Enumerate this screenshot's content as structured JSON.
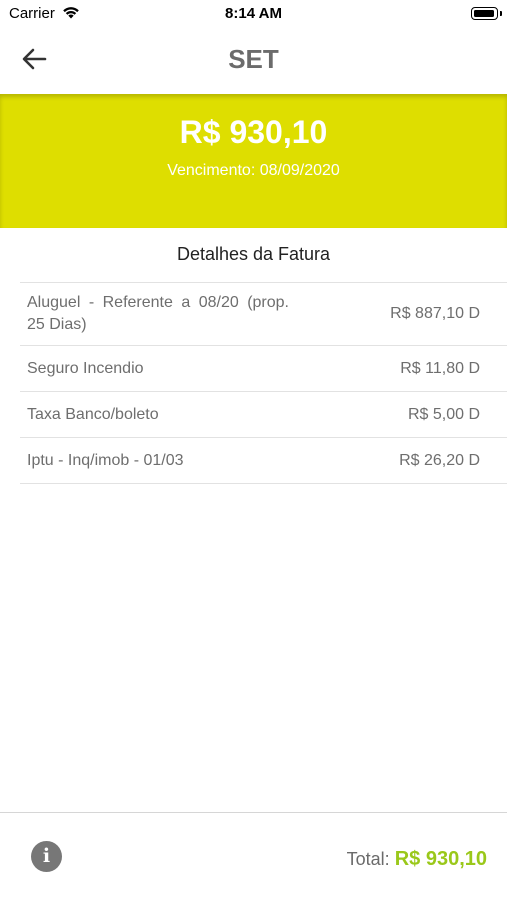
{
  "status": {
    "carrier": "Carrier",
    "time": "8:14 AM"
  },
  "nav": {
    "title": "SET"
  },
  "banner": {
    "amount": "R$ 930,10",
    "due": "Vencimento: 08/09/2020"
  },
  "details": {
    "title": "Detalhes da Fatura",
    "items": [
      {
        "description": "Aluguel - Referente a 08/20 (prop. 25 Dias)",
        "value": "R$ 887,10 D"
      },
      {
        "description": "Seguro Incendio",
        "value": "R$ 11,80 D"
      },
      {
        "description": "Taxa Banco/boleto",
        "value": "R$ 5,00 D"
      },
      {
        "description": "Iptu - Inq/imob - 01/03",
        "value": "R$ 26,20 D"
      }
    ]
  },
  "footer": {
    "total_label": "Total:",
    "total_amount": "R$ 930,10"
  },
  "icons": {
    "back": "arrow-left-icon",
    "info": "info-icon",
    "wifi": "wifi-icon",
    "battery": "battery-icon"
  },
  "colors": {
    "banner": "#dede00",
    "total_amount": "#9ac81a",
    "info_button": "#777777"
  }
}
